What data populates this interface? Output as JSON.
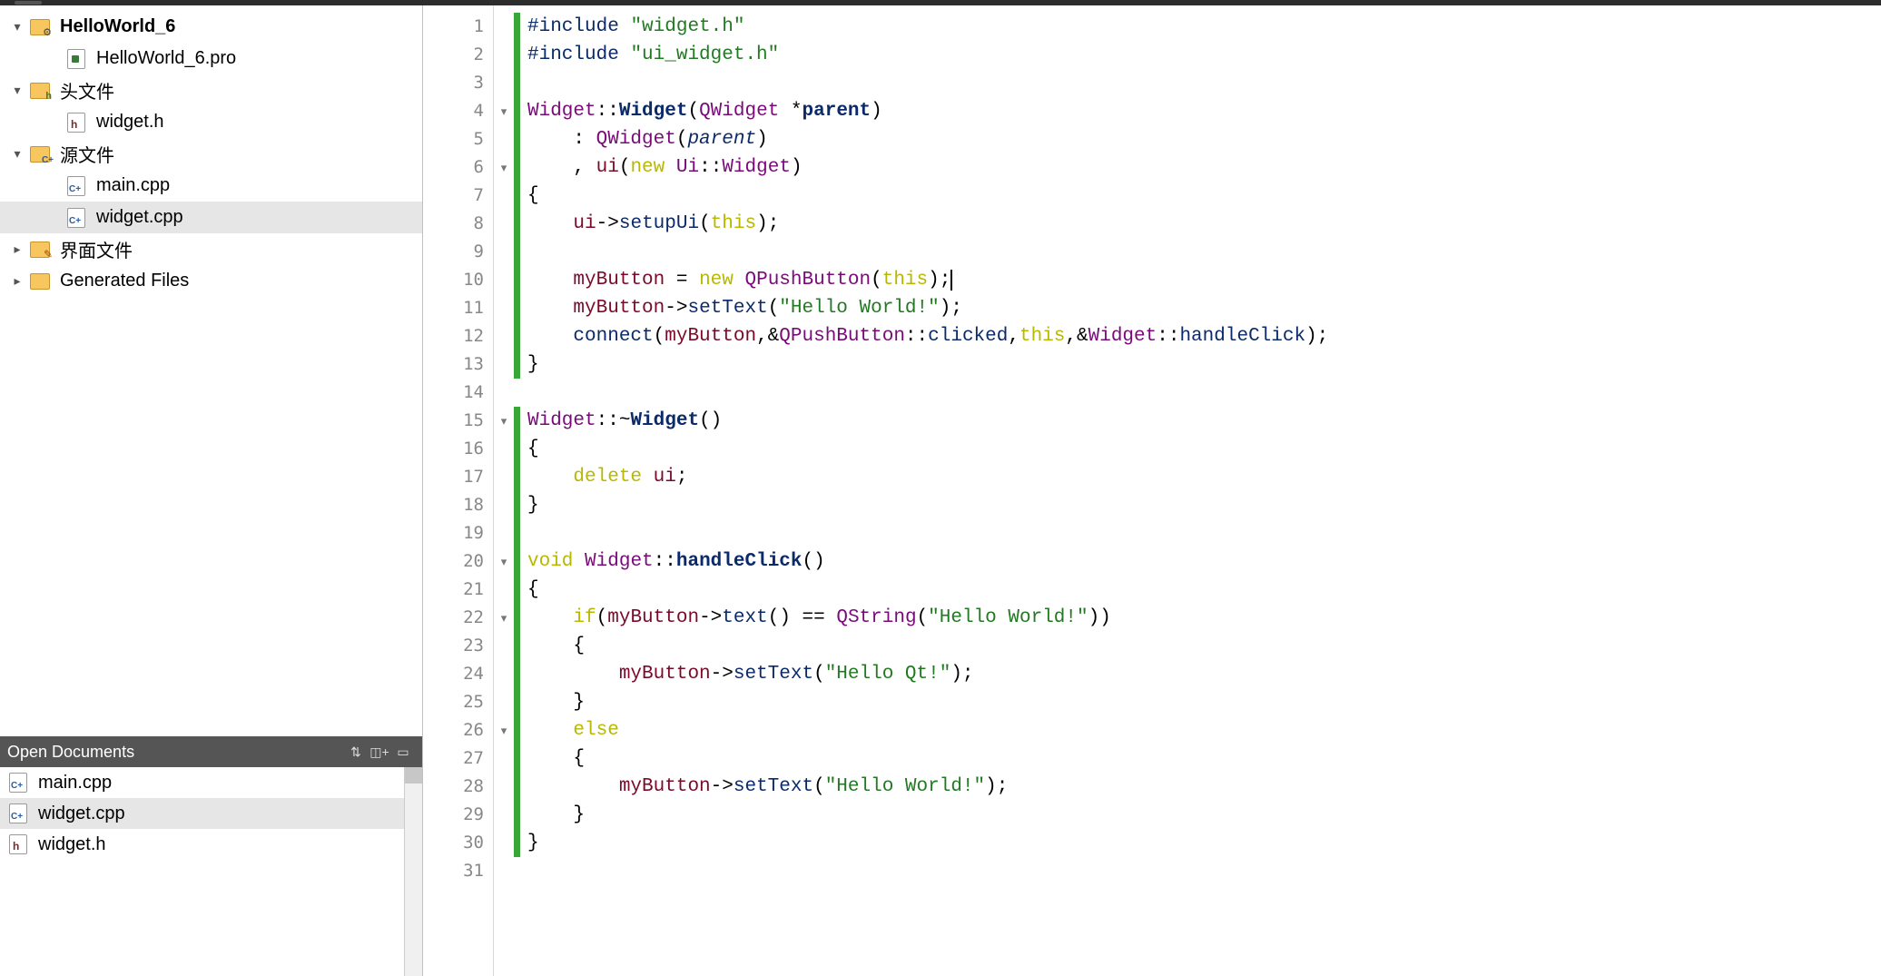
{
  "sidebar": {
    "project_root": "HelloWorld_6",
    "items": [
      {
        "indent": 0,
        "expander": "▾",
        "icon": "folder-gear",
        "label": "HelloWorld_6",
        "bold": true
      },
      {
        "indent": 1,
        "expander": "",
        "icon": "file-pro",
        "label": "HelloWorld_6.pro"
      },
      {
        "indent": 0,
        "expander": "▾",
        "icon": "folder-h",
        "label": "头文件"
      },
      {
        "indent": 1,
        "expander": "",
        "icon": "file-h",
        "label": "widget.h"
      },
      {
        "indent": 0,
        "expander": "▾",
        "icon": "folder-cpp",
        "label": "源文件"
      },
      {
        "indent": 1,
        "expander": "",
        "icon": "file-cpp",
        "label": "main.cpp"
      },
      {
        "indent": 1,
        "expander": "",
        "icon": "file-cpp",
        "label": "widget.cpp",
        "selected": true
      },
      {
        "indent": 0,
        "expander": "▸",
        "icon": "folder-pencil",
        "label": "界面文件"
      },
      {
        "indent": 0,
        "expander": "▸",
        "icon": "folder",
        "label": "Generated Files"
      }
    ],
    "open_docs_title": "Open Documents",
    "open_docs": [
      {
        "icon": "file-cpp",
        "label": "main.cpp"
      },
      {
        "icon": "file-cpp",
        "label": "widget.cpp",
        "selected": true
      },
      {
        "icon": "file-h",
        "label": "widget.h"
      }
    ]
  },
  "editor": {
    "lines": [
      {
        "n": 1,
        "fold": "",
        "mark": "g",
        "segs": [
          [
            "c-pre",
            "#include"
          ],
          [
            "c-plain",
            " "
          ],
          [
            "c-str",
            "\"widget.h\""
          ]
        ]
      },
      {
        "n": 2,
        "fold": "",
        "mark": "g",
        "segs": [
          [
            "c-pre",
            "#include"
          ],
          [
            "c-plain",
            " "
          ],
          [
            "c-str",
            "\"ui_widget.h\""
          ]
        ]
      },
      {
        "n": 3,
        "fold": "",
        "mark": "g",
        "segs": [
          [
            "c-plain",
            ""
          ]
        ]
      },
      {
        "n": 4,
        "fold": "▾",
        "mark": "g",
        "segs": [
          [
            "c-type",
            "Widget"
          ],
          [
            "c-plain",
            "::"
          ],
          [
            "c-func",
            "Widget"
          ],
          [
            "c-plain",
            "("
          ],
          [
            "c-type",
            "QWidget"
          ],
          [
            "c-plain",
            " *"
          ],
          [
            "c-func",
            "parent"
          ],
          [
            "c-plain",
            ")"
          ]
        ]
      },
      {
        "n": 5,
        "fold": "",
        "mark": "g",
        "segs": [
          [
            "c-plain",
            "    : "
          ],
          [
            "c-type",
            "QWidget"
          ],
          [
            "c-plain",
            "("
          ],
          [
            "c-argit",
            "parent"
          ],
          [
            "c-plain",
            ")"
          ]
        ]
      },
      {
        "n": 6,
        "fold": "▾",
        "mark": "g",
        "segs": [
          [
            "c-plain",
            "    , "
          ],
          [
            "c-mem",
            "ui"
          ],
          [
            "c-plain",
            "("
          ],
          [
            "c-kw",
            "new"
          ],
          [
            "c-plain",
            " "
          ],
          [
            "c-type",
            "Ui"
          ],
          [
            "c-plain",
            "::"
          ],
          [
            "c-type",
            "Widget"
          ],
          [
            "c-plain",
            ")"
          ]
        ]
      },
      {
        "n": 7,
        "fold": "",
        "mark": "g",
        "segs": [
          [
            "c-plain",
            "{"
          ]
        ]
      },
      {
        "n": 8,
        "fold": "",
        "mark": "g",
        "segs": [
          [
            "c-plain",
            "    "
          ],
          [
            "c-mem",
            "ui"
          ],
          [
            "c-plain",
            "->"
          ],
          [
            "c-pre",
            "setupUi"
          ],
          [
            "c-plain",
            "("
          ],
          [
            "c-kw",
            "this"
          ],
          [
            "c-plain",
            ");"
          ]
        ]
      },
      {
        "n": 9,
        "fold": "",
        "mark": "g",
        "segs": [
          [
            "c-plain",
            ""
          ]
        ]
      },
      {
        "n": 10,
        "fold": "",
        "mark": "g",
        "segs": [
          [
            "c-plain",
            "    "
          ],
          [
            "c-mem",
            "myButton"
          ],
          [
            "c-plain",
            " = "
          ],
          [
            "c-kw",
            "new"
          ],
          [
            "c-plain",
            " "
          ],
          [
            "c-type",
            "QPushButton"
          ],
          [
            "c-plain",
            "("
          ],
          [
            "c-kw",
            "this"
          ],
          [
            "c-plain",
            ");"
          ]
        ],
        "cursor": true
      },
      {
        "n": 11,
        "fold": "",
        "mark": "g",
        "segs": [
          [
            "c-plain",
            "    "
          ],
          [
            "c-mem",
            "myButton"
          ],
          [
            "c-plain",
            "->"
          ],
          [
            "c-pre",
            "setText"
          ],
          [
            "c-plain",
            "("
          ],
          [
            "c-str",
            "\"Hello World!\""
          ],
          [
            "c-plain",
            ");"
          ]
        ]
      },
      {
        "n": 12,
        "fold": "",
        "mark": "g",
        "segs": [
          [
            "c-plain",
            "    "
          ],
          [
            "c-pre",
            "connect"
          ],
          [
            "c-plain",
            "("
          ],
          [
            "c-mem",
            "myButton"
          ],
          [
            "c-plain",
            ",&"
          ],
          [
            "c-type",
            "QPushButton"
          ],
          [
            "c-plain",
            "::"
          ],
          [
            "c-pre",
            "clicked"
          ],
          [
            "c-plain",
            ","
          ],
          [
            "c-kw",
            "this"
          ],
          [
            "c-plain",
            ",&"
          ],
          [
            "c-type",
            "Widget"
          ],
          [
            "c-plain",
            "::"
          ],
          [
            "c-pre",
            "handleClick"
          ],
          [
            "c-plain",
            ");"
          ]
        ]
      },
      {
        "n": 13,
        "fold": "",
        "mark": "g",
        "segs": [
          [
            "c-plain",
            "}"
          ]
        ]
      },
      {
        "n": 14,
        "fold": "",
        "mark": "",
        "segs": [
          [
            "c-plain",
            ""
          ]
        ]
      },
      {
        "n": 15,
        "fold": "▾",
        "mark": "g",
        "segs": [
          [
            "c-type",
            "Widget"
          ],
          [
            "c-plain",
            "::~"
          ],
          [
            "c-func",
            "Widget"
          ],
          [
            "c-plain",
            "()"
          ]
        ]
      },
      {
        "n": 16,
        "fold": "",
        "mark": "g",
        "segs": [
          [
            "c-plain",
            "{"
          ]
        ]
      },
      {
        "n": 17,
        "fold": "",
        "mark": "g",
        "segs": [
          [
            "c-plain",
            "    "
          ],
          [
            "c-kw",
            "delete"
          ],
          [
            "c-plain",
            " "
          ],
          [
            "c-mem",
            "ui"
          ],
          [
            "c-plain",
            ";"
          ]
        ]
      },
      {
        "n": 18,
        "fold": "",
        "mark": "g",
        "segs": [
          [
            "c-plain",
            "}"
          ]
        ]
      },
      {
        "n": 19,
        "fold": "",
        "mark": "g",
        "segs": [
          [
            "c-plain",
            ""
          ]
        ]
      },
      {
        "n": 20,
        "fold": "▾",
        "mark": "g",
        "segs": [
          [
            "c-kw",
            "void"
          ],
          [
            "c-plain",
            " "
          ],
          [
            "c-type",
            "Widget"
          ],
          [
            "c-plain",
            "::"
          ],
          [
            "c-func",
            "handleClick"
          ],
          [
            "c-plain",
            "()"
          ]
        ]
      },
      {
        "n": 21,
        "fold": "",
        "mark": "g",
        "segs": [
          [
            "c-plain",
            "{"
          ]
        ]
      },
      {
        "n": 22,
        "fold": "▾",
        "mark": "g",
        "segs": [
          [
            "c-plain",
            "    "
          ],
          [
            "c-kw",
            "if"
          ],
          [
            "c-plain",
            "("
          ],
          [
            "c-mem",
            "myButton"
          ],
          [
            "c-plain",
            "->"
          ],
          [
            "c-pre",
            "text"
          ],
          [
            "c-plain",
            "() == "
          ],
          [
            "c-type",
            "QString"
          ],
          [
            "c-plain",
            "("
          ],
          [
            "c-str",
            "\"Hello World!\""
          ],
          [
            "c-plain",
            "))"
          ]
        ]
      },
      {
        "n": 23,
        "fold": "",
        "mark": "g",
        "segs": [
          [
            "c-plain",
            "    {"
          ]
        ]
      },
      {
        "n": 24,
        "fold": "",
        "mark": "g",
        "segs": [
          [
            "c-plain",
            "        "
          ],
          [
            "c-mem",
            "myButton"
          ],
          [
            "c-plain",
            "->"
          ],
          [
            "c-pre",
            "setText"
          ],
          [
            "c-plain",
            "("
          ],
          [
            "c-str",
            "\"Hello Qt!\""
          ],
          [
            "c-plain",
            ");"
          ]
        ]
      },
      {
        "n": 25,
        "fold": "",
        "mark": "g",
        "segs": [
          [
            "c-plain",
            "    }"
          ]
        ]
      },
      {
        "n": 26,
        "fold": "▾",
        "mark": "g",
        "segs": [
          [
            "c-plain",
            "    "
          ],
          [
            "c-kw",
            "else"
          ]
        ]
      },
      {
        "n": 27,
        "fold": "",
        "mark": "g",
        "segs": [
          [
            "c-plain",
            "    {"
          ]
        ]
      },
      {
        "n": 28,
        "fold": "",
        "mark": "g",
        "segs": [
          [
            "c-plain",
            "        "
          ],
          [
            "c-mem",
            "myButton"
          ],
          [
            "c-plain",
            "->"
          ],
          [
            "c-pre",
            "setText"
          ],
          [
            "c-plain",
            "("
          ],
          [
            "c-str",
            "\"Hello World!\""
          ],
          [
            "c-plain",
            ");"
          ]
        ]
      },
      {
        "n": 29,
        "fold": "",
        "mark": "g",
        "segs": [
          [
            "c-plain",
            "    }"
          ]
        ]
      },
      {
        "n": 30,
        "fold": "",
        "mark": "g",
        "segs": [
          [
            "c-plain",
            "}"
          ]
        ]
      },
      {
        "n": 31,
        "fold": "",
        "mark": "",
        "segs": [
          [
            "c-plain",
            ""
          ]
        ]
      }
    ]
  }
}
